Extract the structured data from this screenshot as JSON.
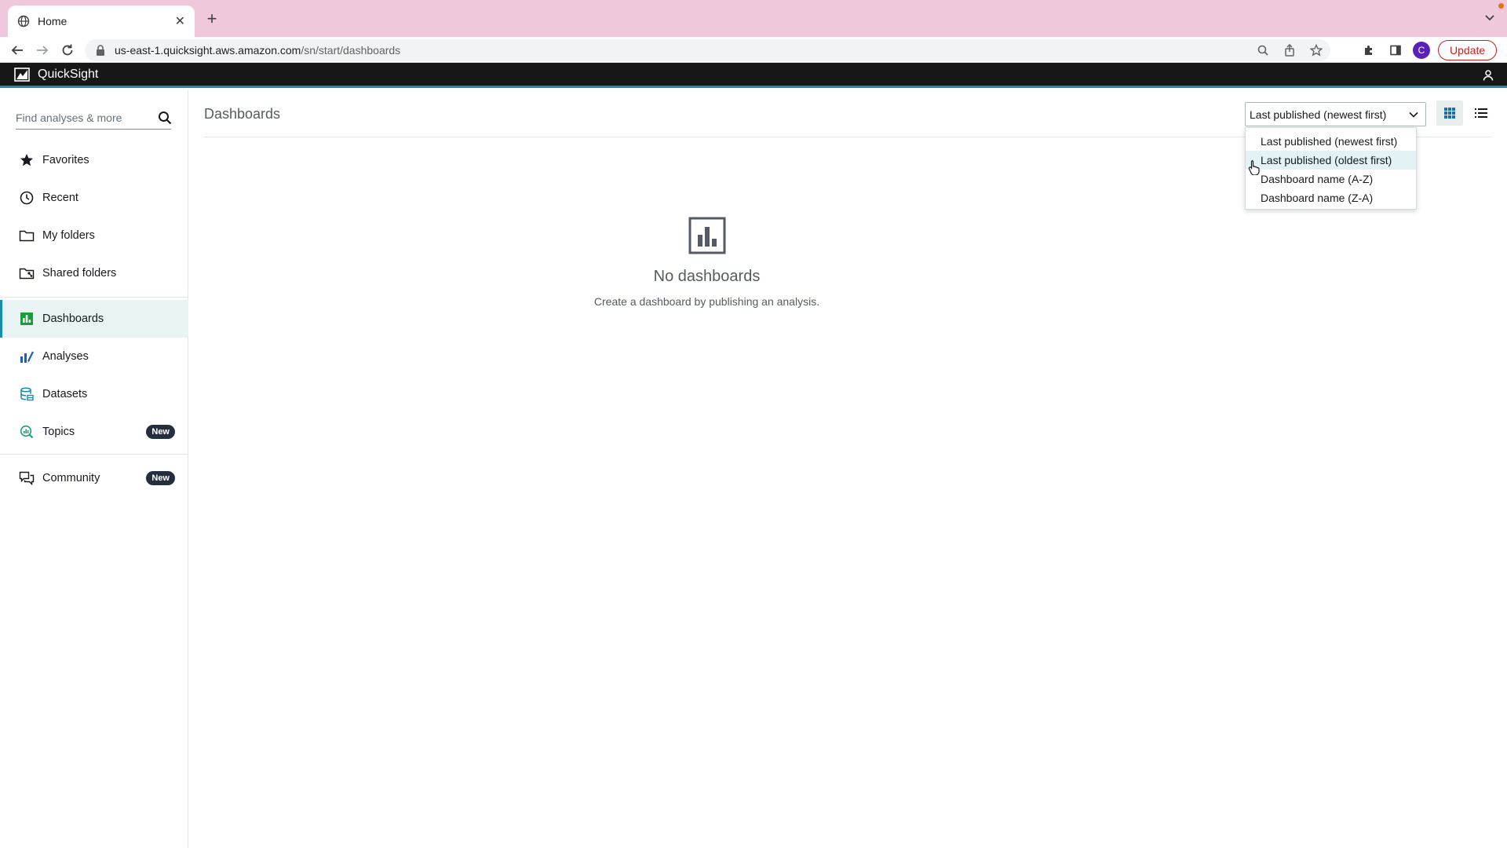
{
  "browser": {
    "tab_title": "Home",
    "url_host": "us-east-1.quicksight.aws.amazon.com",
    "url_path": "/sn/start/dashboards",
    "update_label": "Update",
    "profile_initial": "C"
  },
  "header": {
    "app_name": "QuickSight"
  },
  "sidebar": {
    "search_placeholder": "Find analyses & more",
    "items": [
      {
        "label": "Favorites"
      },
      {
        "label": "Recent"
      },
      {
        "label": "My folders"
      },
      {
        "label": "Shared folders"
      },
      {
        "label": "Dashboards",
        "active": true
      },
      {
        "label": "Analyses"
      },
      {
        "label": "Datasets"
      },
      {
        "label": "Topics",
        "badge": "New"
      },
      {
        "label": "Community",
        "badge": "New"
      }
    ]
  },
  "main": {
    "title": "Dashboards",
    "sort_selected": "Last published (newest first)",
    "sort_options": [
      "Last published (newest first)",
      "Last published (oldest first)",
      "Dashboard name (A-Z)",
      "Dashboard name (Z-A)"
    ],
    "hovered_option_index": 1,
    "empty_title": "No dashboards",
    "empty_subtitle": "Create a dashboard by publishing an analysis."
  },
  "colors": {
    "accent": "#1b8ba8",
    "header_bg": "#171717",
    "tabstrip_bg": "#f0c8dc",
    "active_nav_bg": "#e8f3f4"
  }
}
